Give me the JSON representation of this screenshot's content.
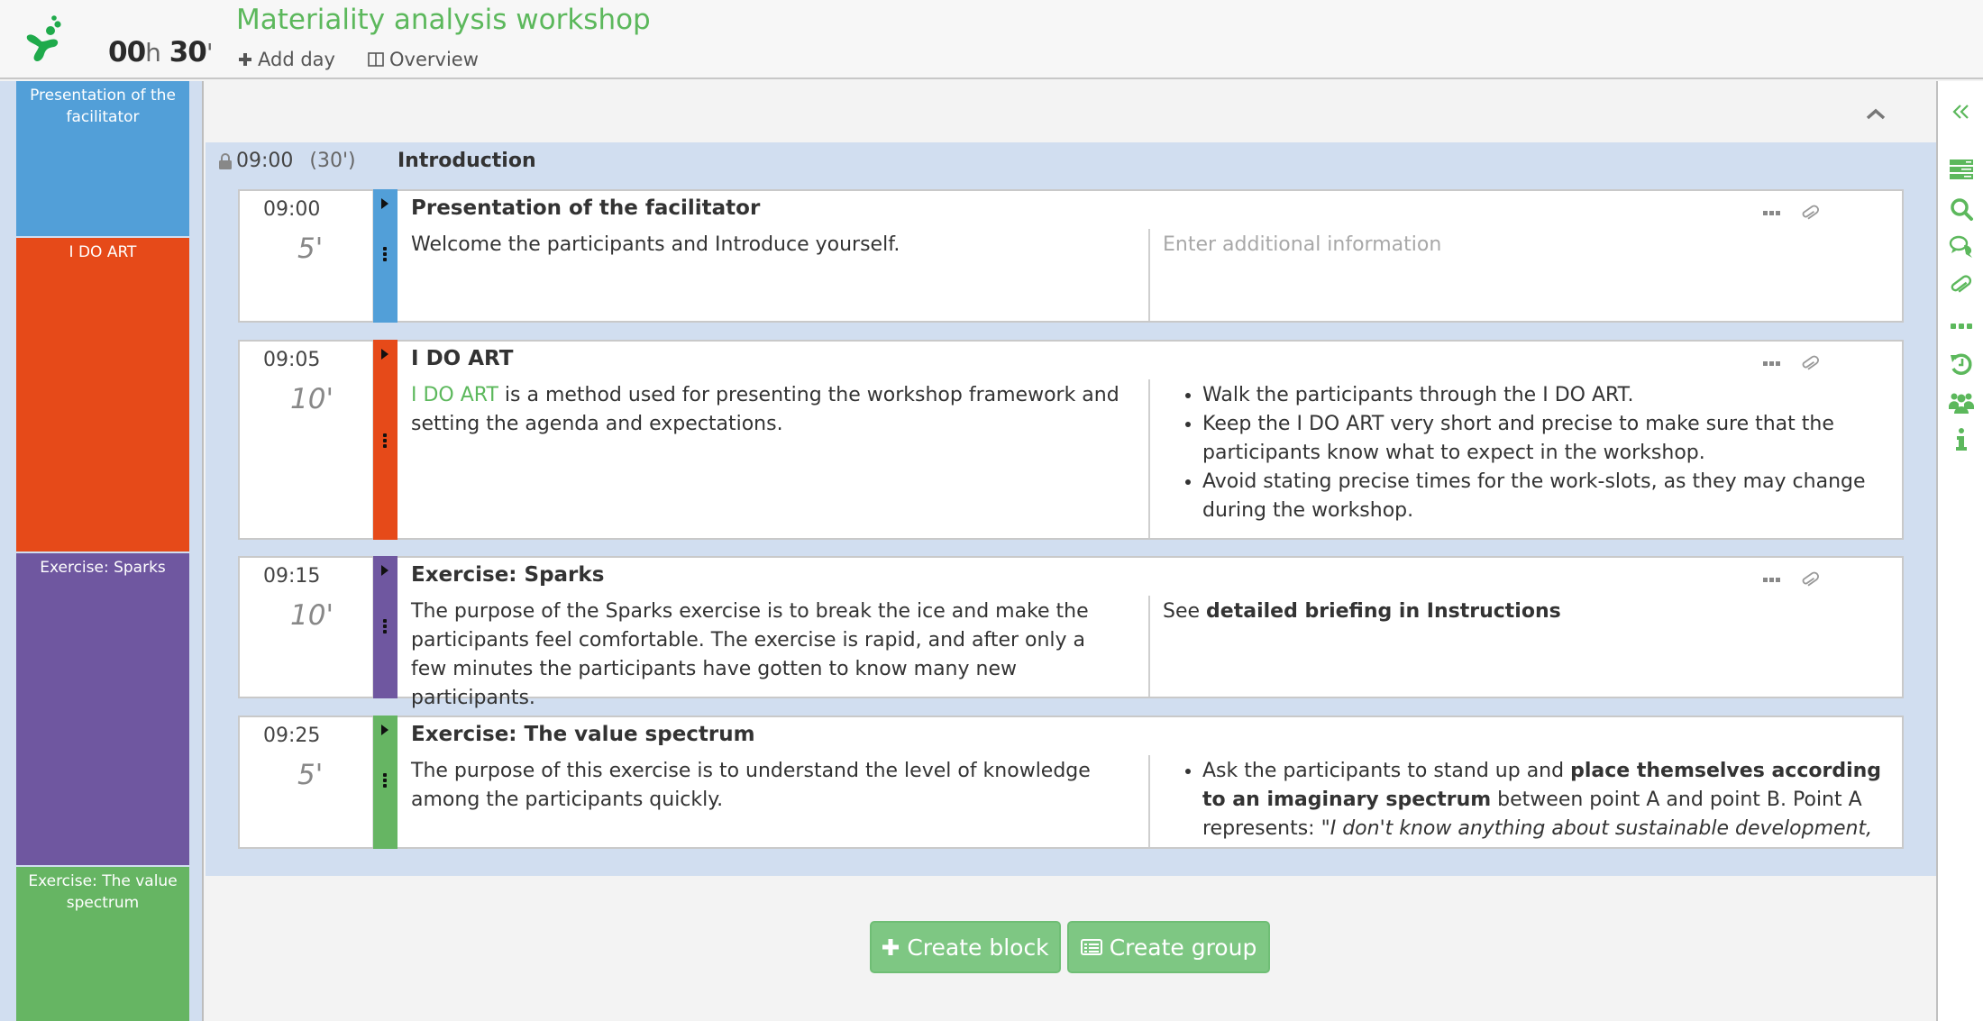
{
  "header": {
    "title": "Materiality analysis workshop",
    "timer": {
      "hours": "00",
      "hours_unit": "h",
      "minutes": "30",
      "minutes_unit": "'"
    },
    "add_day_label": "Add day",
    "overview_label": "Overview"
  },
  "sidebar": {
    "items": [
      {
        "label": "Presentation of the facilitator",
        "color": "#529fd8"
      },
      {
        "label": "I DO ART",
        "color": "#e64a19"
      },
      {
        "label": "Exercise: Sparks",
        "color": "#6f57a0"
      },
      {
        "label": "Exercise: The value spectrum",
        "color": "#66b563"
      }
    ]
  },
  "group": {
    "start": "09:00",
    "duration": "(30')",
    "title": "Introduction",
    "locked": true
  },
  "blocks": [
    {
      "start": "09:00",
      "duration": "5'",
      "title": "Presentation of the facilitator",
      "color": "#529fd8",
      "description": "Welcome the participants and Introduce yourself.",
      "info_placeholder": "Enter additional information"
    },
    {
      "start": "09:05",
      "duration": "10'",
      "title": "I DO ART",
      "color": "#e64a19",
      "description_link": "I DO ART",
      "description": " is a method used for presenting the workshop framework and setting the agenda and expectations.",
      "info_bullets": [
        "Walk the participants through the I DO ART.",
        "Keep the I DO ART very short and precise to make sure that the participants know what to expect in the workshop.",
        "Avoid stating precise times for the work-slots, as they may change during the workshop."
      ]
    },
    {
      "start": "09:15",
      "duration": "10'",
      "title": "Exercise: Sparks",
      "color": "#6f57a0",
      "description": "The purpose of the Sparks exercise is to break the ice and make the participants feel comfortable. The exercise is rapid, and after only a few minutes the participants have gotten to know many new participants.",
      "info_prefix": "See ",
      "info_bold": "detailed briefing in Instructions"
    },
    {
      "start": "09:25",
      "duration": "5'",
      "title": "Exercise: The value spectrum",
      "color": "#66b563",
      "description": "The purpose of this exercise is to understand the level of knowledge among the participants quickly.",
      "info_bullet_parts": {
        "a": "Ask the participants to stand up and ",
        "b_bold": "place themselves according to an imaginary spectrum",
        "c": " between point A and point B. Point A represents: \"",
        "d_italic": "I don't know anything about sustainable development, but I'm willing to"
      }
    }
  ],
  "buttons": {
    "create_block": "Create block",
    "create_group": "Create group"
  },
  "right_rail": {
    "icons": [
      "collapse-panel-icon",
      "agenda-icon",
      "search-icon",
      "comments-icon",
      "attachment-icon",
      "more-icon",
      "history-icon",
      "participants-icon",
      "info-icon"
    ]
  },
  "colors": {
    "accent": "#5cb85c",
    "group_bg": "#d1def0",
    "button_bg": "#7ec783"
  }
}
